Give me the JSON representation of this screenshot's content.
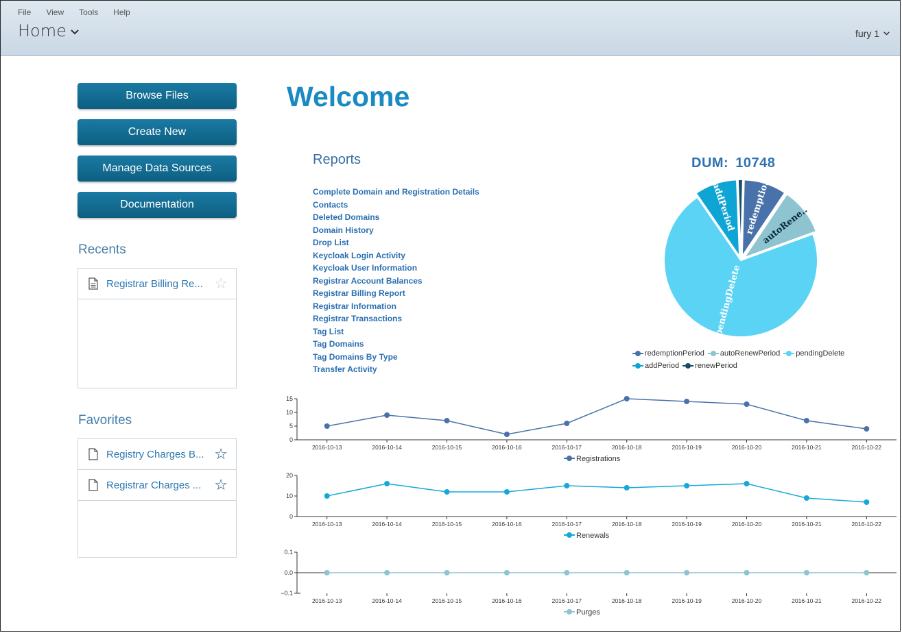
{
  "menu": [
    "File",
    "View",
    "Tools",
    "Help"
  ],
  "header": {
    "title": "Home",
    "user": "fury 1"
  },
  "buttons": [
    "Browse Files",
    "Create New",
    "Manage Data Sources",
    "Documentation"
  ],
  "recents": {
    "title": "Recents",
    "items": [
      "Registrar Billing Re..."
    ]
  },
  "favorites": {
    "title": "Favorites",
    "items": [
      "Registry Charges B...",
      "Registrar Charges ..."
    ]
  },
  "welcome": "Welcome",
  "reports": {
    "title": "Reports",
    "items": [
      "Complete Domain and Registration Details",
      "Contacts",
      "Deleted Domains",
      "Domain History",
      "Drop List",
      "Keycloak Login Activity",
      "Keycloak User Information",
      "Registrar Account Balances",
      "Registrar Billing Report",
      "Registrar Information",
      "Registrar Transactions",
      "Tag List",
      "Tag Domains",
      "Tag Domains By Type",
      "Transfer Activity"
    ]
  },
  "dum": {
    "label": "DUM:",
    "value": "10748"
  },
  "colors": {
    "accent": "#1a8ac3",
    "button": "#0d6a90",
    "redemptionPeriod": "#4a72aa",
    "autoRenewPeriod": "#8ec4cf",
    "pendingDelete": "#5bd3f5",
    "addPeriod": "#0ea5d4",
    "renewPeriod": "#134f67"
  },
  "chart_data": [
    {
      "type": "pie",
      "title": "DUM: 10748",
      "slice_labels": [
        "redemptio..",
        "autoRene..",
        "pendingDelete",
        "addPeriod",
        ""
      ],
      "series": [
        {
          "name": "redemptionPeriod",
          "value": 9,
          "color": "#4a72aa"
        },
        {
          "name": "autoRenewPeriod",
          "value": 10,
          "color": "#8ec4cf"
        },
        {
          "name": "pendingDelete",
          "value": 71,
          "color": "#5bd3f5"
        },
        {
          "name": "addPeriod",
          "value": 9,
          "color": "#0ea5d4"
        },
        {
          "name": "renewPeriod",
          "value": 1,
          "color": "#134f67"
        }
      ],
      "legend": "bottom"
    },
    {
      "type": "line",
      "x": [
        "2016-10-13",
        "2016-10-14",
        "2016-10-15",
        "2016-10-16",
        "2016-10-17",
        "2016-10-18",
        "2016-10-19",
        "2016-10-20",
        "2016-10-21",
        "2016-10-22"
      ],
      "series": [
        {
          "name": "Registrations",
          "values": [
            5,
            9,
            7,
            2,
            6,
            15,
            14,
            13,
            7,
            4
          ],
          "color": "#4a72aa"
        }
      ],
      "ylim": [
        0,
        15
      ],
      "yticks": [
        "0",
        "5",
        "10",
        "15"
      ],
      "legend": "bottom"
    },
    {
      "type": "line",
      "x": [
        "2016-10-13",
        "2016-10-14",
        "2016-10-15",
        "2016-10-16",
        "2016-10-17",
        "2016-10-18",
        "2016-10-19",
        "2016-10-20",
        "2016-10-21",
        "2016-10-22"
      ],
      "series": [
        {
          "name": "Renewals",
          "values": [
            10,
            16,
            12,
            12,
            15,
            14,
            15,
            16,
            9,
            7
          ],
          "color": "#14a9d8"
        }
      ],
      "ylim": [
        0,
        20
      ],
      "yticks": [
        "0",
        "10",
        "20"
      ],
      "legend": "bottom"
    },
    {
      "type": "line",
      "x": [
        "2016-10-13",
        "2016-10-14",
        "2016-10-15",
        "2016-10-16",
        "2016-10-17",
        "2016-10-18",
        "2016-10-19",
        "2016-10-20",
        "2016-10-21",
        "2016-10-22"
      ],
      "series": [
        {
          "name": "Purges",
          "values": [
            0,
            0,
            0,
            0,
            0,
            0,
            0,
            0,
            0,
            0
          ],
          "color": "#8ec4cf"
        }
      ],
      "ylim": [
        -0.1,
        0.1
      ],
      "yticks": [
        "−0.1",
        "0.0",
        "0.1"
      ],
      "legend": "bottom"
    }
  ]
}
